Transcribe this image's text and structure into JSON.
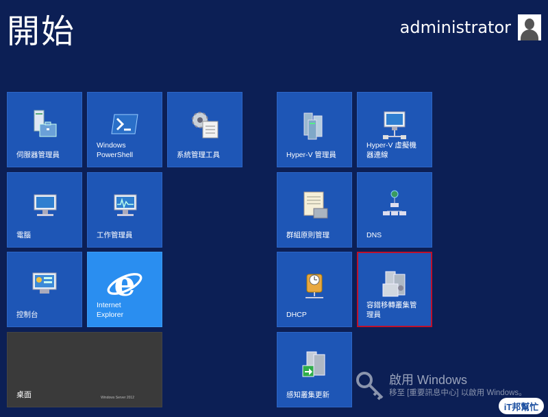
{
  "header": {
    "title": "開始",
    "username": "administrator"
  },
  "tiles": {
    "server_manager": "伺服器管理員",
    "powershell": "Windows\nPowerShell",
    "admin_tools": "系統管理工具",
    "computer": "電腦",
    "task_manager": "工作管理員",
    "control_panel": "控制台",
    "internet_explorer": "Internet\nExplorer",
    "desktop": "桌面",
    "desktop_brand": "Windows Server 2012",
    "hyperv_manager": "Hyper-V 管理員",
    "hyperv_vm_connect": "Hyper-V 虛擬機\n器連線",
    "group_policy": "群組原則管理",
    "dns": "DNS",
    "dhcp": "DHCP",
    "failover_cluster": "容錯移轉叢集管\n理員",
    "cluster_aware_update": "感知叢集更新"
  },
  "watermark": {
    "title": "啟用 Windows",
    "subtitle": "移至 [重要訊息中心] 以啟用 Windows。",
    "badge": "iT邦幫忙"
  },
  "colors": {
    "background": "#0c1f55",
    "tile": "#1e56b6",
    "ie_tile": "#2a8ef0",
    "desktop_tile": "#3a3a3a",
    "selection": "#c0102a"
  }
}
